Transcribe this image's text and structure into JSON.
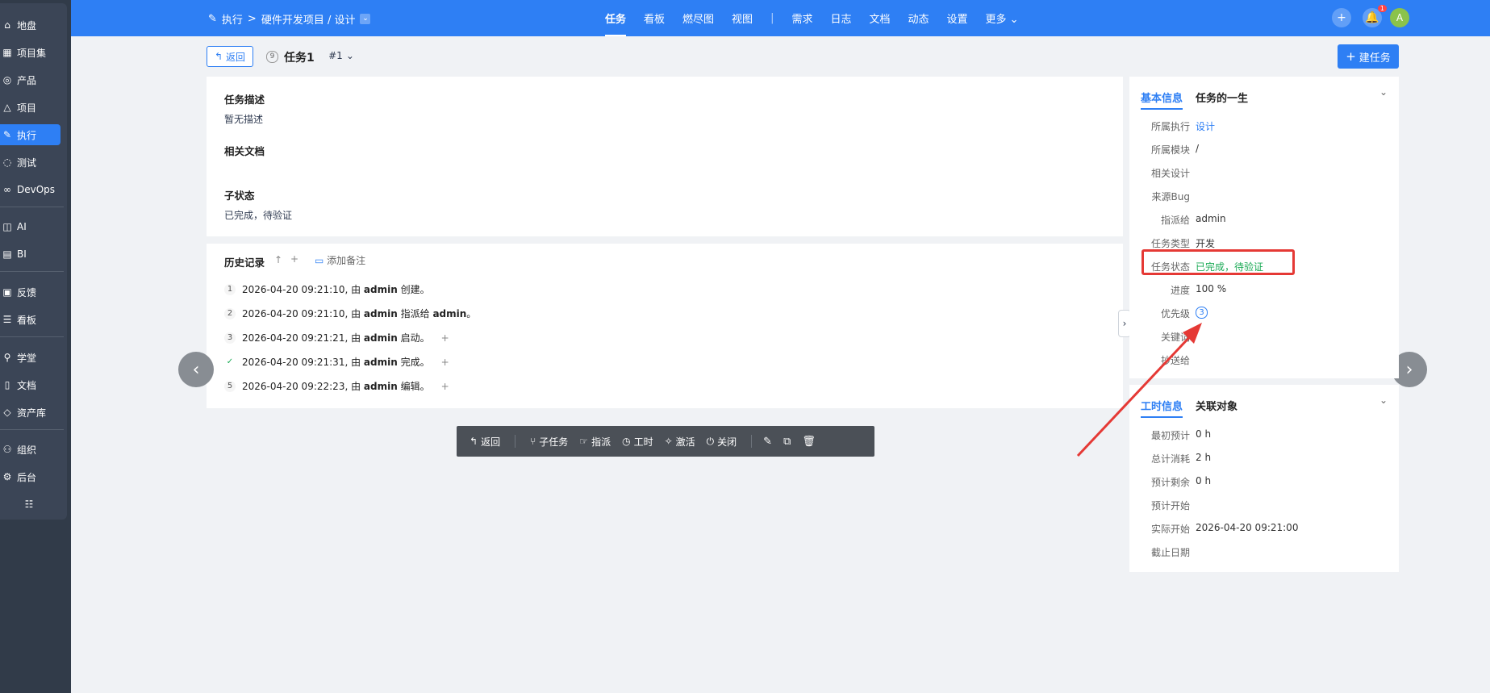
{
  "sidebar": {
    "items": [
      {
        "icon": "home-icon",
        "label": "地盘"
      },
      {
        "icon": "grid-icon",
        "label": "项目集"
      },
      {
        "icon": "location-icon",
        "label": "产品"
      },
      {
        "icon": "project-icon",
        "label": "项目"
      },
      {
        "icon": "execute-icon",
        "label": "执行"
      },
      {
        "icon": "test-icon",
        "label": "测试"
      },
      {
        "icon": "infinity-icon",
        "label": "DevOps"
      },
      {
        "icon": "ai-icon",
        "label": "AI"
      },
      {
        "icon": "bi-icon",
        "label": "BI"
      },
      {
        "icon": "feedback-icon",
        "label": "反馈"
      },
      {
        "icon": "kanban-icon",
        "label": "看板"
      },
      {
        "icon": "school-icon",
        "label": "学堂"
      },
      {
        "icon": "doc-icon",
        "label": "文档"
      },
      {
        "icon": "asset-icon",
        "label": "资产库"
      },
      {
        "icon": "org-icon",
        "label": "组织"
      },
      {
        "icon": "settings-icon",
        "label": "后台"
      }
    ],
    "active_index": 4
  },
  "topbar": {
    "breadcrumb_exec": "执行",
    "breadcrumb_sep": ">",
    "breadcrumb_project": "硬件开发项目 / 设计",
    "nav": [
      "任务",
      "看板",
      "燃尽图",
      "视图",
      "|",
      "需求",
      "日志",
      "文档",
      "动态",
      "设置",
      "更多"
    ],
    "notification_badge": "1",
    "avatar_letter": "A"
  },
  "header": {
    "back_label": "返回",
    "task_id": "9",
    "task_title": "任务1",
    "task_selector": "#1",
    "create_label": "建任务"
  },
  "description": {
    "desc_title": "任务描述",
    "desc_value": "暂无描述",
    "docs_title": "相关文档",
    "substatus_title": "子状态",
    "substatus_value": "已完成，待验证"
  },
  "history": {
    "title": "历史记录",
    "add_note": "添加备注",
    "rows": [
      {
        "num": "1",
        "time": "2026-04-20 09:21:10, 由",
        "user": "admin",
        "action": "创建。",
        "expand": ""
      },
      {
        "num": "2",
        "time": "2026-04-20 09:21:10, 由",
        "user": "admin",
        "action": "指派给",
        "target": "admin",
        "end": "。",
        "expand": ""
      },
      {
        "num": "3",
        "time": "2026-04-20 09:21:21, 由",
        "user": "admin",
        "action": "启动。",
        "expand": "+"
      },
      {
        "num": "✓",
        "time": "2026-04-20 09:21:31, 由",
        "user": "admin",
        "action": "完成。",
        "expand": "+"
      },
      {
        "num": "5",
        "time": "2026-04-20 09:22:23, 由",
        "user": "admin",
        "action": "编辑。",
        "expand": "+"
      }
    ]
  },
  "toolbar": {
    "back": "返回",
    "subtask": "子任务",
    "assign": "指派",
    "effort": "工时",
    "activate": "激活",
    "close": "关闭"
  },
  "basic_info": {
    "tab_active": "基本信息",
    "tab_other": "任务的一生",
    "rows": [
      {
        "label": "所属执行",
        "value": "设计"
      },
      {
        "label": "所属模块",
        "value": "/"
      },
      {
        "label": "相关设计",
        "value": ""
      },
      {
        "label": "来源Bug",
        "value": ""
      },
      {
        "label": "指派给",
        "value": "admin"
      },
      {
        "label": "任务类型",
        "value": "开发"
      },
      {
        "label": "任务状态",
        "value": "已完成，待验证"
      },
      {
        "label": "进度",
        "value": "100 %"
      },
      {
        "label": "优先级",
        "value": "3"
      },
      {
        "label": "关键词",
        "value": ""
      },
      {
        "label": "抄送给",
        "value": ""
      }
    ]
  },
  "effort_info": {
    "tab_active": "工时信息",
    "tab_other": "关联对象",
    "rows": [
      {
        "label": "最初预计",
        "value": "0 h"
      },
      {
        "label": "总计消耗",
        "value": "2 h"
      },
      {
        "label": "预计剩余",
        "value": "0 h"
      },
      {
        "label": "预计开始",
        "value": ""
      },
      {
        "label": "实际开始",
        "value": "2026-04-20 09:21:00"
      },
      {
        "label": "截止日期",
        "value": ""
      }
    ]
  },
  "colors": {
    "primary": "#2e7ff4",
    "sidebar": "#3b4556",
    "status_green": "#1aaa55",
    "highlight_red": "#e53935"
  }
}
